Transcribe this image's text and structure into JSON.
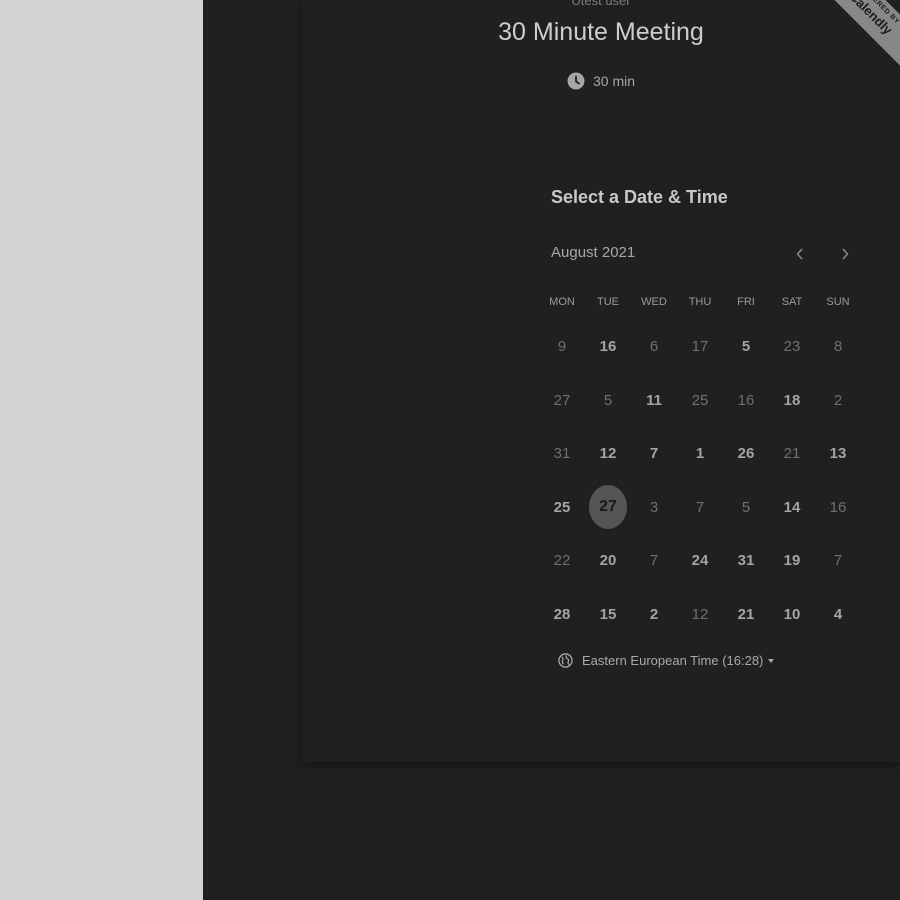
{
  "app": {
    "user_name": "Utest user",
    "brand_small": "POWERED BY",
    "brand_main": "Calendly"
  },
  "event": {
    "title": "30 Minute Meeting",
    "duration": "30 min",
    "duration_icon": "clock-icon"
  },
  "calendar": {
    "section_title": "Select a Date & Time",
    "month_label": "August 2021",
    "prev_icon": "chevron-left-icon",
    "next_icon": "chevron-right-icon",
    "weekdays": [
      "MON",
      "TUE",
      "WED",
      "THU",
      "FRI",
      "SAT",
      "SUN"
    ],
    "selected_day": "27",
    "days": [
      {
        "label": "9",
        "available": false
      },
      {
        "label": "16",
        "available": true
      },
      {
        "label": "6",
        "available": false
      },
      {
        "label": "17",
        "available": false
      },
      {
        "label": "5",
        "available": true
      },
      {
        "label": "23",
        "available": false
      },
      {
        "label": "8",
        "available": false
      },
      {
        "label": "27",
        "available": false
      },
      {
        "label": "5",
        "available": false
      },
      {
        "label": "11",
        "available": true
      },
      {
        "label": "25",
        "available": false
      },
      {
        "label": "16",
        "available": false
      },
      {
        "label": "18",
        "available": true
      },
      {
        "label": "2",
        "available": false
      },
      {
        "label": "31",
        "available": false
      },
      {
        "label": "12",
        "available": true
      },
      {
        "label": "7",
        "available": true
      },
      {
        "label": "1",
        "available": true
      },
      {
        "label": "26",
        "available": true
      },
      {
        "label": "21",
        "available": false
      },
      {
        "label": "13",
        "available": true
      },
      {
        "label": "25",
        "available": true
      },
      {
        "label": "27",
        "available": true,
        "selected": true
      },
      {
        "label": "3",
        "available": false
      },
      {
        "label": "7",
        "available": false
      },
      {
        "label": "5",
        "available": false
      },
      {
        "label": "14",
        "available": true
      },
      {
        "label": "16",
        "available": false
      },
      {
        "label": "22",
        "available": false
      },
      {
        "label": "20",
        "available": true
      },
      {
        "label": "7",
        "available": false
      },
      {
        "label": "24",
        "available": true
      },
      {
        "label": "31",
        "available": true
      },
      {
        "label": "19",
        "available": true
      },
      {
        "label": "7",
        "available": false
      },
      {
        "label": "28",
        "available": true
      },
      {
        "label": "15",
        "available": true
      },
      {
        "label": "2",
        "available": true
      },
      {
        "label": "12",
        "available": false
      },
      {
        "label": "21",
        "available": true
      },
      {
        "label": "10",
        "available": true
      },
      {
        "label": "4",
        "available": true
      }
    ]
  },
  "timezone": {
    "label": "Eastern European Time (16:28)",
    "icon": "globe-icon"
  },
  "colors": {
    "page_bg": "#d3d3d3",
    "panel_bg": "#1f1f1f",
    "selected_bg": "#555555",
    "badge_bg": "#878787"
  }
}
